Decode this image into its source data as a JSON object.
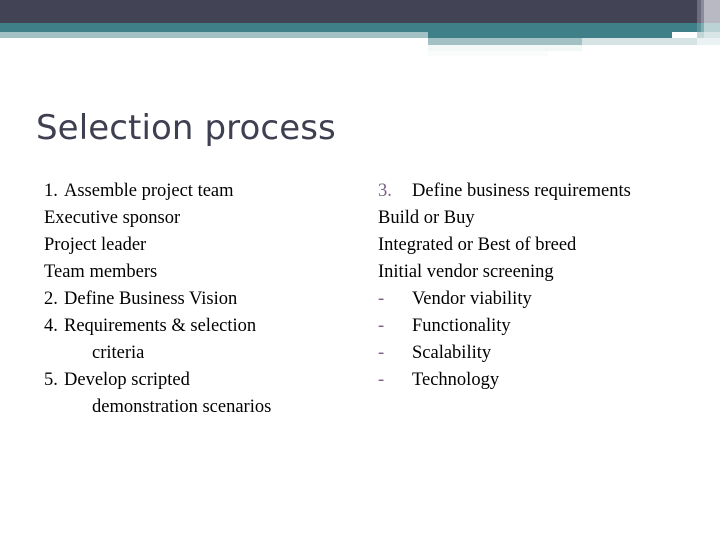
{
  "slide": {
    "title": "Selection process",
    "title_color": "#3f3f52",
    "background": "#ffffff"
  },
  "decor": {
    "navy": "#434356",
    "teal": "#3f7f87",
    "light_blue": "#a3c0c4",
    "pale_blue": "#d5e3e4",
    "stripe_gray": "#b9b9c4",
    "accent_purple": "#7a5f86"
  },
  "content": {
    "left_column": [
      {
        "marker": "1.",
        "text": "Assemble project team",
        "indent": false,
        "accent": false
      },
      {
        "marker": "",
        "text": "Executive sponsor",
        "indent": false,
        "accent": false
      },
      {
        "marker": "",
        "text": "Project leader",
        "indent": false,
        "accent": false
      },
      {
        "marker": "",
        "text": "Team members",
        "indent": false,
        "accent": false
      },
      {
        "marker": "2.",
        "text": "Define Business Vision",
        "indent": false,
        "accent": false
      },
      {
        "marker": "4.",
        "text": "Requirements & selection",
        "indent": false,
        "accent": false
      },
      {
        "marker": "",
        "text": "criteria",
        "indent": true,
        "accent": false
      },
      {
        "marker": "5.",
        "text": "Develop scripted",
        "indent": false,
        "accent": false
      },
      {
        "marker": "",
        "text": "demonstration scenarios",
        "indent": true,
        "accent": false
      }
    ],
    "right_column": [
      {
        "marker": "3.",
        "text": "Define business requirements",
        "indent": false,
        "accent": true
      },
      {
        "marker": "",
        "text": "Build or Buy",
        "indent": false,
        "accent": false
      },
      {
        "marker": "",
        "text": "Integrated or Best of breed",
        "indent": false,
        "accent": false
      },
      {
        "marker": "",
        "text": "Initial vendor screening",
        "indent": false,
        "accent": false
      },
      {
        "marker": "-",
        "text": "Vendor viability",
        "indent": false,
        "accent": true
      },
      {
        "marker": "-",
        "text": "Functionality",
        "indent": false,
        "accent": true
      },
      {
        "marker": "-",
        "text": "Scalability",
        "indent": false,
        "accent": true
      },
      {
        "marker": "-",
        "text": "Technology",
        "indent": false,
        "accent": true
      }
    ]
  }
}
